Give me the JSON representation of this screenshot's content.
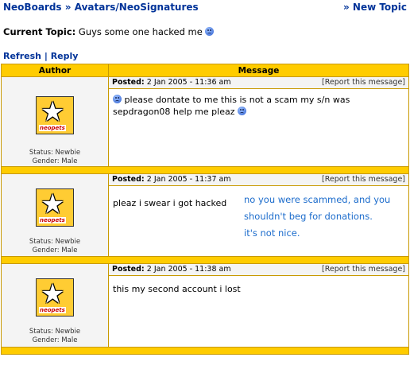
{
  "breadcrumb": {
    "neoboards": "NeoBoards",
    "separator": "»",
    "board": "Avatars/NeoSignatures"
  },
  "new_topic": "» New Topic",
  "current_topic": {
    "label": "Current Topic:",
    "title": "Guys some one hacked me"
  },
  "actions": {
    "refresh": "Refresh",
    "divider": "|",
    "reply": "Reply"
  },
  "table": {
    "author_header": "Author",
    "message_header": "Message"
  },
  "posts": [
    {
      "status": "Status: Newbie",
      "gender": "Gender: Male",
      "posted_label": "Posted:",
      "posted_time": "2 Jan 2005 - 11:36 am",
      "report": "[Report this message]",
      "text": "please dontate to me this is not a scam my s/n was sepdragon08 help me pleaz"
    },
    {
      "status": "Status: Newbie",
      "gender": "Gender: Male",
      "posted_label": "Posted:",
      "posted_time": "2 Jan 2005 - 11:37 am",
      "report": "[Report this message]",
      "text": "pleaz i swear i got hacked",
      "annotation": [
        "no you were scammed, and you",
        "shouldn't beg for donations.",
        "it's not nice."
      ]
    },
    {
      "status": "Status: Newbie",
      "gender": "Gender: Male",
      "posted_label": "Posted:",
      "posted_time": "2 Jan 2005 - 11:38 am",
      "report": "[Report this message]",
      "text": "this my second account i lost"
    }
  ],
  "avatar_logo": "neopets",
  "icons": {
    "sad": "sad-face-icon",
    "avatar": "neopets-star-icon"
  },
  "colors": {
    "header_yellow": "#ffcc00",
    "link_blue": "#003399",
    "annotation_blue": "#1c6ccc"
  }
}
